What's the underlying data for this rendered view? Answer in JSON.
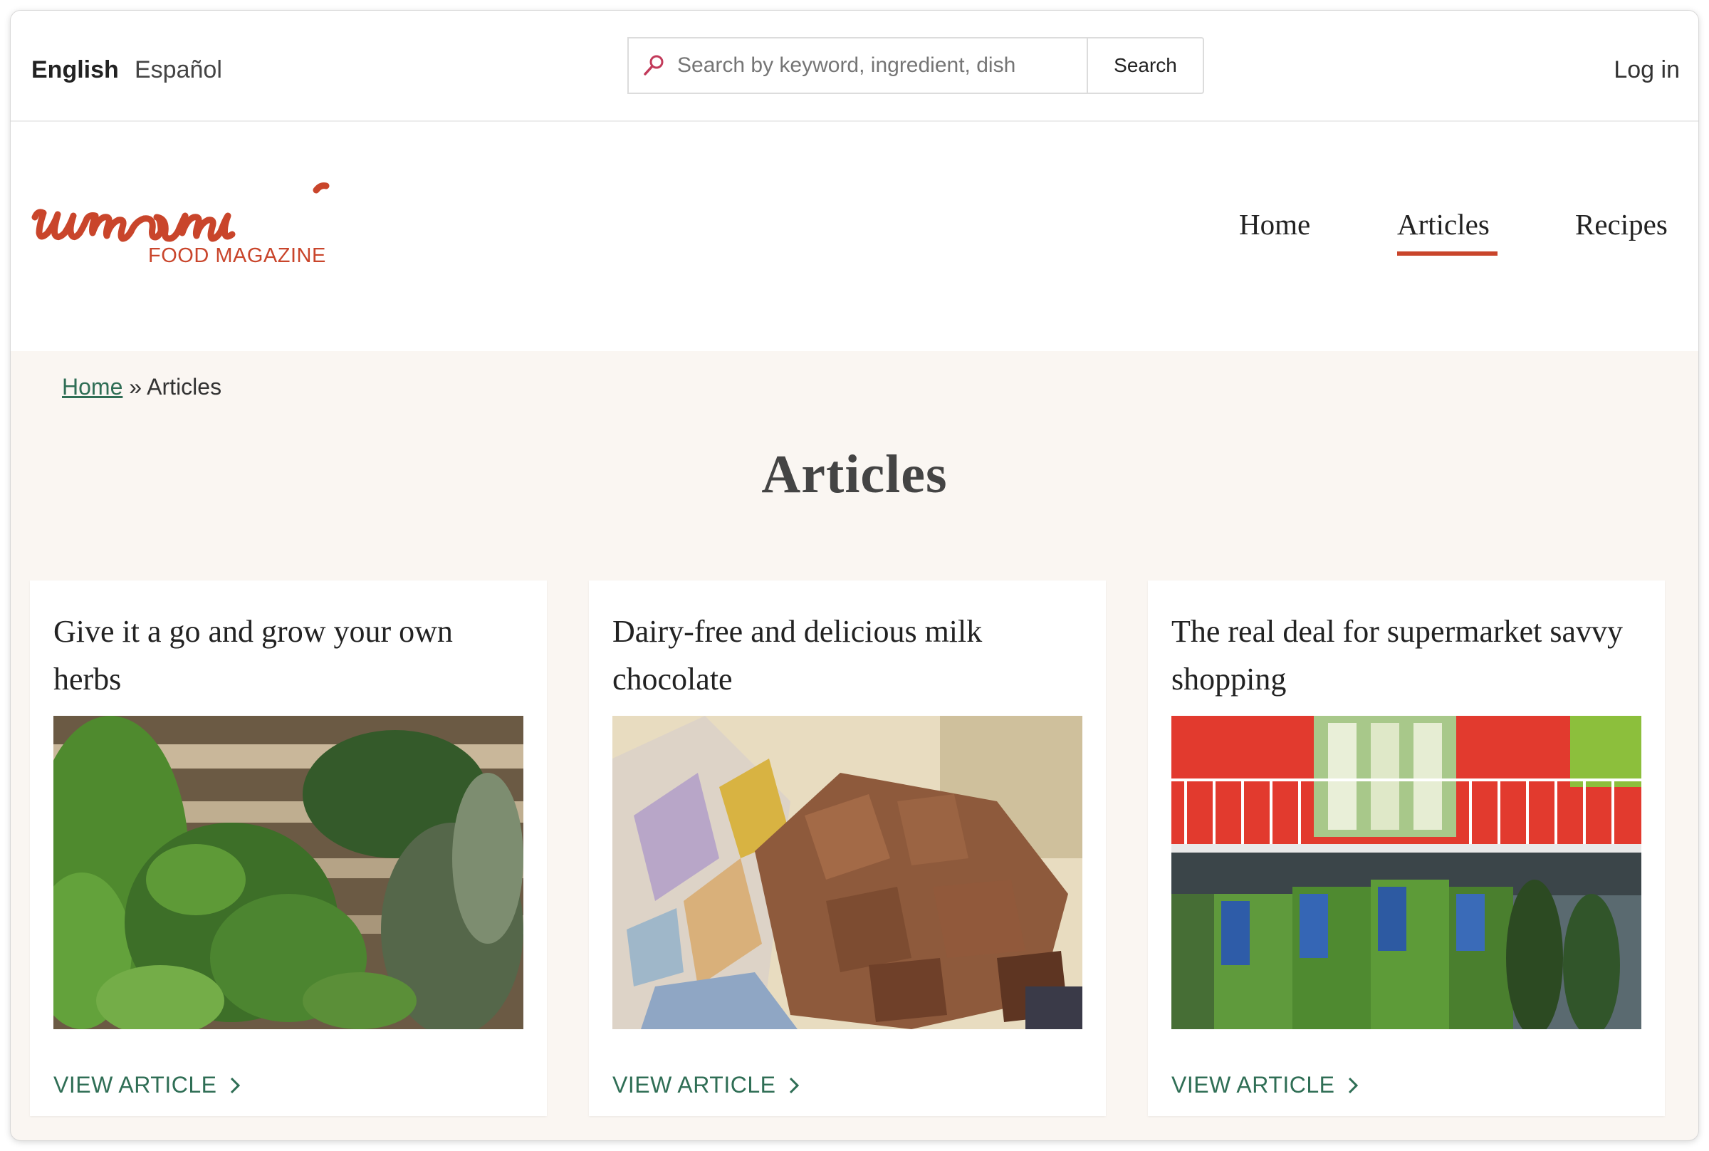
{
  "topbar": {
    "languages": [
      "English",
      "Español"
    ],
    "search": {
      "placeholder": "Search by keyword, ingredient, dish",
      "button_label": "Search"
    },
    "login_label": "Log in"
  },
  "header": {
    "logo_text": "umami",
    "logo_subtitle": "FOOD MAGAZINE",
    "nav": [
      {
        "label": "Home",
        "active": false
      },
      {
        "label": "Articles",
        "active": true
      },
      {
        "label": "Recipes",
        "active": false
      }
    ]
  },
  "breadcrumb": {
    "home": "Home",
    "separator": " » ",
    "current": "Articles"
  },
  "page_title": "Articles",
  "articles": [
    {
      "title": "Give it a go and grow your own herbs",
      "link_label": "VIEW ARTICLE",
      "image_icon": "herbs-photo"
    },
    {
      "title": "Dairy-free and delicious milk chocolate",
      "link_label": "VIEW ARTICLE",
      "image_icon": "chocolate-photo"
    },
    {
      "title": "The real deal for supermarket savvy shopping",
      "link_label": "VIEW ARTICLE",
      "image_icon": "supermarket-photo"
    }
  ],
  "colors": {
    "accent": "#c9452b",
    "link": "#2f6e55",
    "background": "#faf6f2"
  }
}
